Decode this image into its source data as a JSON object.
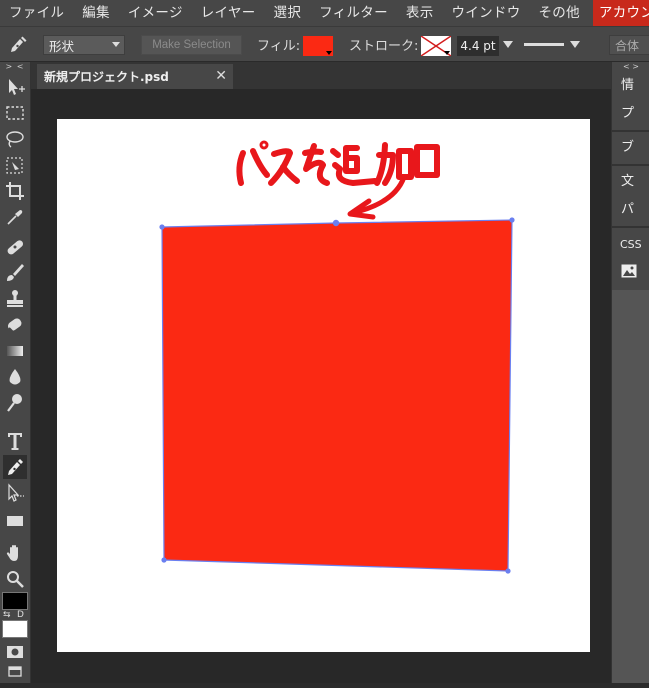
{
  "menu": {
    "items": [
      "ファイル",
      "編集",
      "イメージ",
      "レイヤー",
      "選択",
      "フィルター",
      "表示",
      "ウインドウ",
      "その他"
    ],
    "account": "アカウント"
  },
  "options": {
    "shape_mode": "形状",
    "make_selection": "Make Selection",
    "fill_label": "フィル:",
    "fill_color": "#fb2913",
    "stroke_label": "ストローク:",
    "stroke_width": "4.4 pt",
    "merge_mode": "合体"
  },
  "toolbar": {
    "collapse": "> <",
    "tools": [
      "move-tool-icon",
      "marquee-tool-icon",
      "lasso-tool-icon",
      "quick-select-tool-icon",
      "crop-tool-icon",
      "eyedropper-tool-icon",
      "healing-tool-icon",
      "brush-tool-icon",
      "stamp-tool-icon",
      "eraser-tool-icon",
      "gradient-tool-icon",
      "blur-tool-icon",
      "dodge-tool-icon",
      "type-tool-icon",
      "pen-tool-icon",
      "path-select-tool-icon",
      "rectangle-tool-icon",
      "hand-tool-icon",
      "zoom-tool-icon"
    ],
    "active_tool": "pen-tool-icon",
    "swap_label": "⇆",
    "default_label": "D",
    "foreground_color": "#000000",
    "background_color": "#ffffff"
  },
  "document": {
    "tab_title": "新規プロジェクト.psd",
    "close_glyph": "✕"
  },
  "canvas": {
    "background": "#ffffff",
    "shape_color": "#fb2913",
    "path_color": "#6a7ff0",
    "annotation_text": "パスを追加",
    "annotation_color": "#e8171b"
  },
  "right_panel": {
    "collapse": "< >",
    "items": [
      "情",
      "プ",
      "ブ",
      "文",
      "パ",
      "CSS"
    ],
    "image_icon": "image-icon"
  }
}
